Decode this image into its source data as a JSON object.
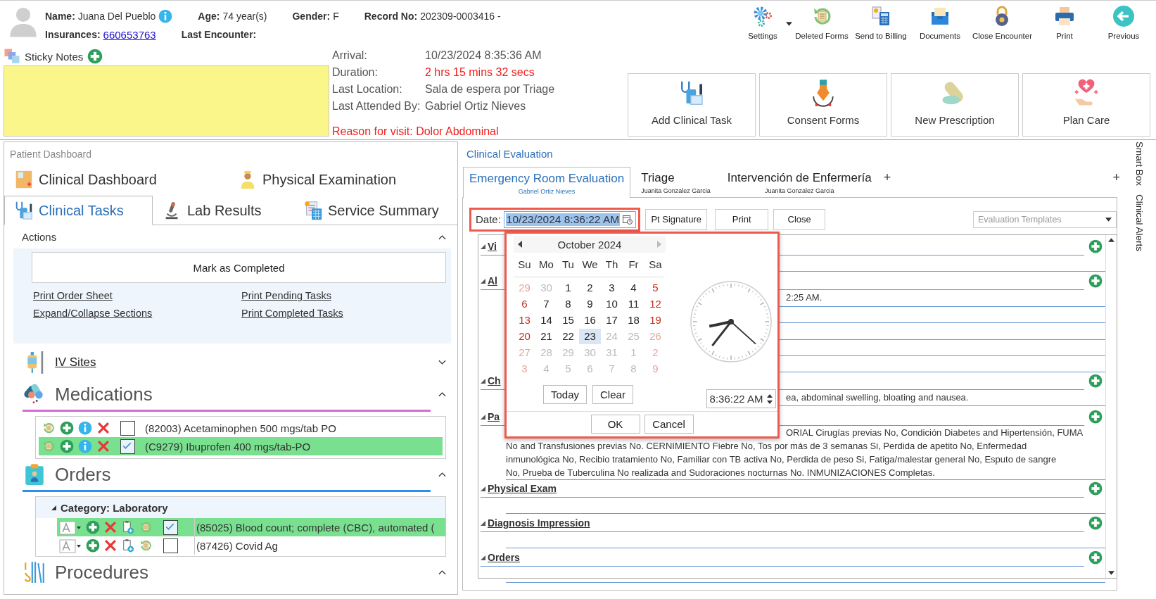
{
  "patient": {
    "row1": [
      {
        "label": "Name:",
        "value": "Juana Del Pueblo",
        "kind": "info"
      },
      {
        "label": "Age:",
        "value": "74 year(s)",
        "kind": "text"
      },
      {
        "label": "Gender:",
        "value": "F",
        "kind": "text"
      },
      {
        "label": "Record No:",
        "value": "202309-0003416 -",
        "kind": "text"
      }
    ],
    "row2": [
      {
        "label": "Insurances:",
        "value": "660653763",
        "kind": "link"
      },
      {
        "label": "Last Encounter:",
        "kind": "text"
      }
    ]
  },
  "toolbar": [
    {
      "label": "Settings",
      "has_menu": true
    },
    {
      "label": "Deleted Forms",
      "has_menu": false
    },
    {
      "label": "Send to Billing",
      "has_menu": false
    },
    {
      "label": "Documents",
      "has_menu": false
    },
    {
      "label": "Close Encounter",
      "has_menu": false
    },
    {
      "label": "Print",
      "has_menu": false
    },
    {
      "label": "Previous",
      "has_menu": false
    }
  ],
  "sticky_notes": {
    "label": "Sticky Notes"
  },
  "visit": [
    {
      "label": "Arrival:",
      "value": "10/23/2024 8:35:36 AM",
      "alert": false
    },
    {
      "label": "Duration:",
      "value": "2 hrs 15 mins 32 secs",
      "alert": true
    },
    {
      "label": "Last Location:",
      "value": "Sala de espera por Triage",
      "alert": false
    },
    {
      "label": "Last Attended By:",
      "value": "Gabriel Ortiz Nieves",
      "alert": false
    }
  ],
  "reason": "Reason for visit: Dolor Abdominal",
  "quick_actions": [
    "Add Clinical Task",
    "Consent Forms",
    "New Prescription",
    "Plan Care"
  ],
  "dashboard": {
    "title": "Patient Dashboard",
    "tab_rows": [
      [
        {
          "label": "Clinical Dashboard",
          "selected": false
        },
        {
          "label": "Physical Examination",
          "selected": false
        }
      ],
      [
        {
          "label": "Clinical Tasks",
          "selected": true
        },
        {
          "label": "Lab Results",
          "selected": false
        },
        {
          "label": "Service Summary",
          "selected": false
        }
      ]
    ],
    "actions": {
      "title": "Actions",
      "expanded": true,
      "button": "Mark as Completed",
      "links": [
        "Print Order Sheet",
        "Print Pending Tasks",
        "Expand/Collapse Sections",
        "Print Completed Tasks"
      ]
    },
    "sections": [
      {
        "title": "IV Sites",
        "kind": "link",
        "expanded": false
      },
      {
        "title": "Medications",
        "kind": "meds",
        "expanded": true,
        "color": "#d56ad6",
        "items": [
          {
            "text": "(82003) Acetaminophen 500 mgs/tab PO",
            "checked": false,
            "selected": false
          },
          {
            "text": "(C9279) Ibuprofen 400 mgs/tab-PO",
            "checked": true,
            "selected": true
          }
        ]
      },
      {
        "title": "Orders",
        "kind": "orders",
        "expanded": true,
        "color": "#2f8ff0",
        "category": "Category: Laboratory",
        "items": [
          {
            "text": "(85025) Blood count; complete (CBC), automated (",
            "checked": true,
            "selected": true
          },
          {
            "text": "(87426) Covid Ag",
            "checked": false,
            "selected": false
          }
        ]
      },
      {
        "title": "Procedures",
        "kind": "plain",
        "expanded": true
      }
    ]
  },
  "evaluation": {
    "title": "Clinical Evaluation",
    "tabs": [
      {
        "label": "Emergency Room Evaluation",
        "author": "Gabriel Ortiz Nieves",
        "selected": true
      },
      {
        "label": "Triage",
        "author": "Juanita Gonzalez Garcia",
        "selected": false
      },
      {
        "label": "Intervención de Enfermería",
        "author": "Juanita Gonzalez Garcia",
        "selected": false
      }
    ],
    "add_tab": "+",
    "add_panel": "+",
    "date_label": "Date:",
    "date_value": "10/23/2024 8:36:22 AM",
    "buttons": [
      "Pt Signature",
      "Print",
      "Close"
    ],
    "templates": {
      "placeholder": "Evaluation Templates"
    },
    "sections": [
      {
        "title": "Vi"
      },
      {
        "title": "Al",
        "lines": [
          {
            "text": "2:25 AM.",
            "kind": "cut"
          }
        ]
      },
      {
        "title": "Ch",
        "lines": [
          {
            "text": "ea, abdominal swelling, bloating and nausea.",
            "kind": "cut"
          }
        ]
      },
      {
        "title": "Pa",
        "lines": [
          {
            "text": "ORIAL Cirugías previas No, Condición Diabetes and Hipertensión, FUMA",
            "kind": "cut"
          },
          {
            "text": "No and Transfusiones previas No. CERNIMIENTO Fiebre No, Tos por más de 3 semanas Si, Perdida de apetito No, Enfermedad",
            "kind": "full"
          },
          {
            "text": "inmunológica No, Recibio tratamiento No, Familiar con TB activa No, Perdida de peso Si, Fatiga/malestar general No, Esputo de sangre",
            "kind": "full"
          },
          {
            "text": "No, Prueba de Tuberculina No realizada and Sudoraciones nocturnas No. INMUNIZACIONES Completas.",
            "kind": "full"
          }
        ]
      },
      {
        "title": "Physical Exam"
      },
      {
        "title": "Diagnosis Impression"
      },
      {
        "title": "Orders"
      }
    ]
  },
  "date_picker": {
    "month": "October 2024",
    "weekdays": [
      "Su",
      "Mo",
      "Tu",
      "We",
      "Th",
      "Fr",
      "Sa"
    ],
    "days": [
      {
        "n": "29",
        "muted": true,
        "weekend": true,
        "selected": false
      },
      {
        "n": "30",
        "muted": true,
        "weekend": false,
        "selected": false
      },
      {
        "n": "1",
        "muted": false,
        "weekend": false,
        "selected": false
      },
      {
        "n": "2",
        "muted": false,
        "weekend": false,
        "selected": false
      },
      {
        "n": "3",
        "muted": false,
        "weekend": false,
        "selected": false
      },
      {
        "n": "4",
        "muted": false,
        "weekend": false,
        "selected": false
      },
      {
        "n": "5",
        "muted": false,
        "weekend": true,
        "selected": false
      },
      {
        "n": "6",
        "muted": false,
        "weekend": true,
        "selected": false
      },
      {
        "n": "7",
        "muted": false,
        "weekend": false,
        "selected": false
      },
      {
        "n": "8",
        "muted": false,
        "weekend": false,
        "selected": false
      },
      {
        "n": "9",
        "muted": false,
        "weekend": false,
        "selected": false
      },
      {
        "n": "10",
        "muted": false,
        "weekend": false,
        "selected": false
      },
      {
        "n": "11",
        "muted": false,
        "weekend": false,
        "selected": false
      },
      {
        "n": "12",
        "muted": false,
        "weekend": true,
        "selected": false
      },
      {
        "n": "13",
        "muted": false,
        "weekend": true,
        "selected": false
      },
      {
        "n": "14",
        "muted": false,
        "weekend": false,
        "selected": false
      },
      {
        "n": "15",
        "muted": false,
        "weekend": false,
        "selected": false
      },
      {
        "n": "16",
        "muted": false,
        "weekend": false,
        "selected": false
      },
      {
        "n": "17",
        "muted": false,
        "weekend": false,
        "selected": false
      },
      {
        "n": "18",
        "muted": false,
        "weekend": false,
        "selected": false
      },
      {
        "n": "19",
        "muted": false,
        "weekend": true,
        "selected": false
      },
      {
        "n": "20",
        "muted": false,
        "weekend": true,
        "selected": false
      },
      {
        "n": "21",
        "muted": false,
        "weekend": false,
        "selected": false
      },
      {
        "n": "22",
        "muted": false,
        "weekend": false,
        "selected": false
      },
      {
        "n": "23",
        "muted": false,
        "weekend": false,
        "selected": true
      },
      {
        "n": "24",
        "muted": true,
        "weekend": false,
        "selected": false
      },
      {
        "n": "25",
        "muted": true,
        "weekend": false,
        "selected": false
      },
      {
        "n": "26",
        "muted": true,
        "weekend": true,
        "selected": false
      },
      {
        "n": "27",
        "muted": true,
        "weekend": true,
        "selected": false
      },
      {
        "n": "28",
        "muted": true,
        "weekend": false,
        "selected": false
      },
      {
        "n": "29",
        "muted": true,
        "weekend": false,
        "selected": false
      },
      {
        "n": "30",
        "muted": true,
        "weekend": false,
        "selected": false
      },
      {
        "n": "31",
        "muted": true,
        "weekend": false,
        "selected": false
      },
      {
        "n": "1",
        "muted": true,
        "weekend": false,
        "selected": false
      },
      {
        "n": "2",
        "muted": true,
        "weekend": true,
        "selected": false
      },
      {
        "n": "3",
        "muted": true,
        "weekend": true,
        "selected": false
      },
      {
        "n": "4",
        "muted": true,
        "weekend": false,
        "selected": false
      },
      {
        "n": "5",
        "muted": true,
        "weekend": false,
        "selected": false
      },
      {
        "n": "6",
        "muted": true,
        "weekend": false,
        "selected": false
      },
      {
        "n": "7",
        "muted": true,
        "weekend": false,
        "selected": false
      },
      {
        "n": "8",
        "muted": true,
        "weekend": false,
        "selected": false
      },
      {
        "n": "9",
        "muted": true,
        "weekend": true,
        "selected": false
      }
    ],
    "time": "8:36:22 AM",
    "buttons": [
      "Today",
      "Clear"
    ],
    "footer_buttons": [
      "OK",
      "Cancel"
    ]
  },
  "side_tabs": [
    "Smart Box",
    "Clinical Alerts"
  ]
}
